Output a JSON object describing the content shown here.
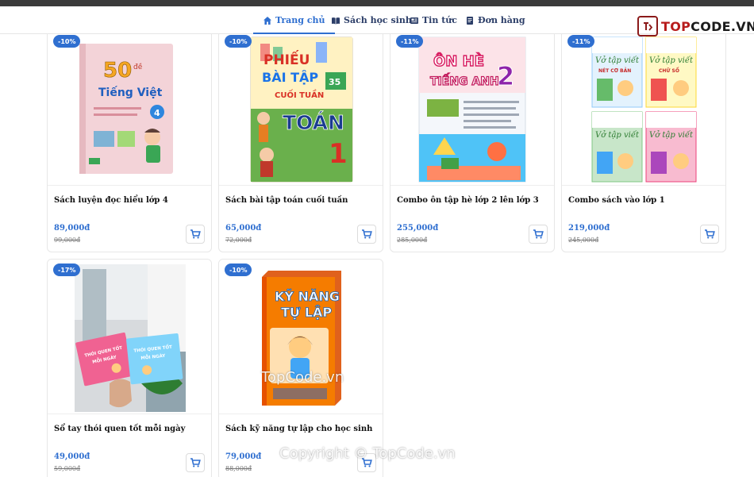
{
  "nav": {
    "items": [
      {
        "label": "Trang chủ",
        "icon": "home-icon",
        "active": true
      },
      {
        "label": "Sách học sinh",
        "icon": "book-open-icon",
        "active": false
      },
      {
        "label": "Tin tức",
        "icon": "news-icon",
        "active": false
      },
      {
        "label": "Đơn hàng",
        "icon": "orders-icon",
        "active": false
      }
    ],
    "active_color": "#2f6fd0",
    "text_color": "#2c3e68"
  },
  "logo": {
    "part1": "TOP",
    "part2": "CODE.VN",
    "brand_color": "#b71c1c"
  },
  "products": [
    {
      "discount": "-10%",
      "title": "Sách luyện đọc hiểu lớp 4",
      "price": "89,000đ",
      "old_price": "99,000đ",
      "cover": {
        "big": "50",
        "small": "đề",
        "line1": "Tiếng Việt",
        "grade": "4"
      }
    },
    {
      "discount": "-10%",
      "title": "Sách bài tập toán cuối tuần",
      "price": "65,000đ",
      "old_price": "72,000đ",
      "cover": {
        "line1": "PHIẾU",
        "line2": "BÀI TẬP",
        "line3": "CUỐI TUẦN",
        "weeks": "35",
        "subject": "TOÁN",
        "grade": "1"
      }
    },
    {
      "discount": "-11%",
      "title": "Combo ôn tập hè lớp 2 lên lớp 3",
      "price": "255,000đ",
      "old_price": "285,000đ",
      "cover": {
        "line1": "ÔN HÈ",
        "line2": "TIẾNG ANH",
        "grade": "2"
      }
    },
    {
      "discount": "-11%",
      "title": "Combo sách vào lớp 1",
      "price": "219,000đ",
      "old_price": "245,000đ",
      "cover": {
        "line1": "Vở tập viết",
        "sub1": "NÉT CƠ BẢN",
        "sub2": "CHỮ SỐ"
      }
    },
    {
      "discount": "-17%",
      "title": "Sổ tay thói quen tốt mỗi ngày",
      "price": "49,000đ",
      "old_price": "59,000đ",
      "cover": {
        "line1": "THÓI QUEN TỐT",
        "line2": "MỖI NGÀY"
      }
    },
    {
      "discount": "-10%",
      "title": "Sách kỹ năng tự lập cho học sinh",
      "price": "79,000đ",
      "old_price": "88,000đ",
      "cover": {
        "line1": "KỸ NĂNG",
        "line2": "TỰ LẬP"
      }
    }
  ],
  "watermarks": {
    "center": "TopCode.vn",
    "footer": "Copyright © TopCode.vn"
  },
  "colors": {
    "accent": "#2f6fd0",
    "brand_red": "#b71c1c"
  }
}
